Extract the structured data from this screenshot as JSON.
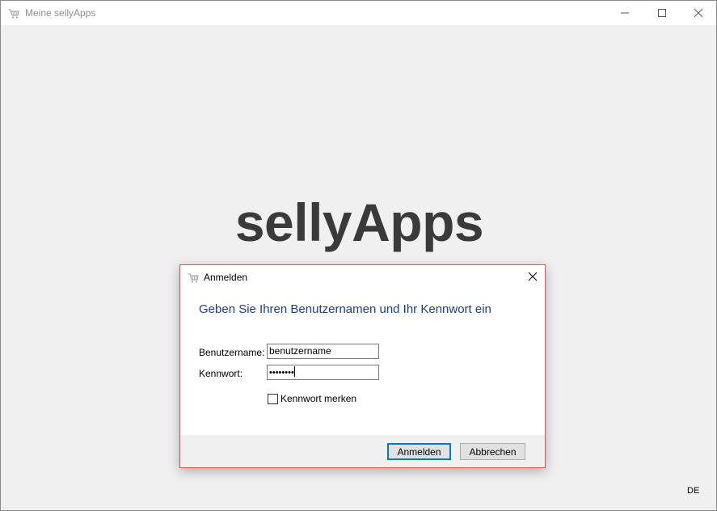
{
  "window": {
    "title": "Meine sellyApps",
    "controls": [
      "minimize-icon",
      "maximize-icon",
      "close-icon"
    ]
  },
  "brand": {
    "text": "sellyApps",
    "color": "#3a3a3a"
  },
  "status": {
    "language": "DE"
  },
  "dialog": {
    "title": "Anmelden",
    "heading": "Geben Sie Ihren Benutzernamen und Ihr Kennwort ein",
    "heading_color": "#1c3e8e",
    "border_color": "#d9514f",
    "username_label": "Benutzername:",
    "username_value": "benutzername",
    "password_label": "Kennwort:",
    "password_value": "••••••••",
    "remember_label": "Kennwort merken",
    "remember_checked": false,
    "ok_label": "Anmelden",
    "cancel_label": "Abbrechen"
  }
}
